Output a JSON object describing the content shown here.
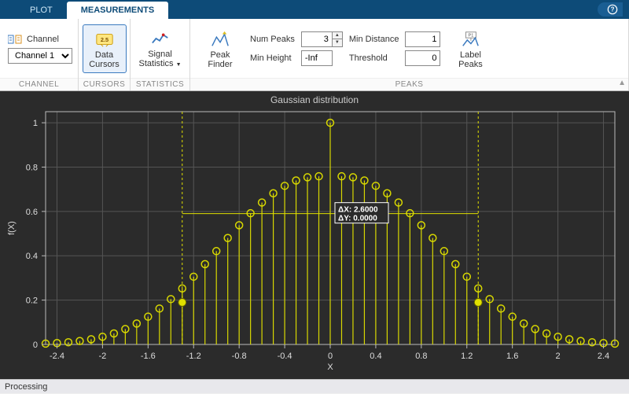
{
  "tabs": {
    "plot": "PLOT",
    "measurements": "MEASUREMENTS"
  },
  "sections": {
    "channel": "CHANNEL",
    "cursors": "CURSORS",
    "statistics": "STATISTICS",
    "peaks": "PEAKS"
  },
  "channel": {
    "label": "Channel",
    "selected": "Channel 1"
  },
  "buttons": {
    "data_cursors_l1": "Data",
    "data_cursors_l2": "Cursors",
    "signal_stats_l1": "Signal",
    "signal_stats_l2": "Statistics",
    "peak_finder_l1": "Peak",
    "peak_finder_l2": "Finder",
    "label_peaks_l1": "Label",
    "label_peaks_l2": "Peaks"
  },
  "peaks": {
    "num_label": "Num Peaks",
    "num_value": "3",
    "mindist_label": "Min Distance",
    "mindist_value": "1",
    "minheight_label": "Min Height",
    "minheight_value": "-Inf",
    "threshold_label": "Threshold",
    "threshold_value": "0"
  },
  "status": "Processing",
  "chart_data": {
    "type": "stem",
    "title": "Gaussian distribution",
    "xlabel": "X",
    "ylabel": "f(X)",
    "xlim": [
      -2.5,
      2.5
    ],
    "ylim": [
      0,
      1.05
    ],
    "xticks": [
      -2.4,
      -2.0,
      -1.6,
      -1.2,
      -0.8,
      -0.4,
      0,
      0.4,
      0.8,
      1.2,
      1.6,
      2.0,
      2.4
    ],
    "yticks": [
      0,
      0.2,
      0.4,
      0.6,
      0.8,
      1.0
    ],
    "x": [
      -2.5,
      -2.4,
      -2.3,
      -2.2,
      -2.1,
      -2.0,
      -1.9,
      -1.8,
      -1.7,
      -1.6,
      -1.5,
      -1.4,
      -1.3,
      -1.2,
      -1.1,
      -1.0,
      -0.9,
      -0.8,
      -0.7,
      -0.6,
      -0.5,
      -0.4,
      -0.3,
      -0.2,
      -0.1,
      0.0,
      0.1,
      0.2,
      0.3,
      0.4,
      0.5,
      0.6,
      0.7,
      0.8,
      0.9,
      1.0,
      1.1,
      1.2,
      1.3,
      1.4,
      1.5,
      1.6,
      1.7,
      1.8,
      1.9,
      2.0,
      2.1,
      2.2,
      2.3,
      2.4,
      2.5
    ],
    "y": [
      0.0038,
      0.0062,
      0.0099,
      0.0155,
      0.0235,
      0.0347,
      0.0497,
      0.0695,
      0.0945,
      0.1253,
      0.162,
      0.2046,
      0.2528,
      0.3057,
      0.3623,
      0.4211,
      0.4803,
      0.5379,
      0.5918,
      0.6404,
      0.682,
      0.7154,
      0.7396,
      0.7541,
      0.7585,
      1.0,
      0.7585,
      0.7541,
      0.7396,
      0.7154,
      0.682,
      0.6404,
      0.5918,
      0.5379,
      0.4803,
      0.4211,
      0.3623,
      0.3057,
      0.2528,
      0.2046,
      0.162,
      0.1253,
      0.0945,
      0.0695,
      0.0497,
      0.0347,
      0.0235,
      0.0155,
      0.0099,
      0.0062,
      0.0038
    ],
    "cursors": [
      {
        "x": -1.3,
        "y": 0.19
      },
      {
        "x": 1.3,
        "y": 0.19
      }
    ],
    "delta_label_1": "ΔX: 2.6000",
    "delta_label_2": "ΔY: 0.0000"
  }
}
